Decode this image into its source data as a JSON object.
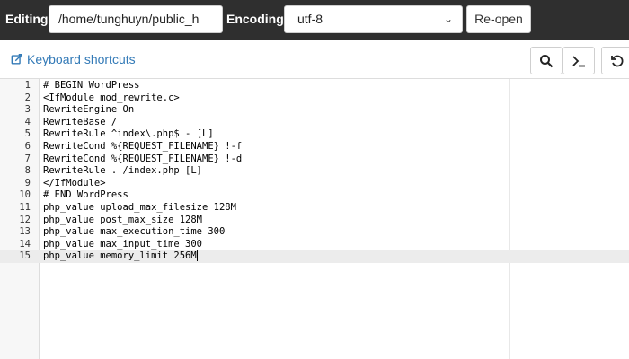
{
  "header": {
    "editing_label": "Editing:",
    "path_value": "/home/tunghuyn/public_h",
    "encoding_label": "Encoding:",
    "encoding_value": "utf-8",
    "reopen_label": "Re-open"
  },
  "toolbar": {
    "keyboard_shortcuts_label": "Keyboard shortcuts",
    "buttons": [
      "search-icon",
      "terminal-icon",
      "undo-icon"
    ]
  },
  "colors": {
    "topbar_bg": "#2f2f2f",
    "link": "#337ab7",
    "active_line": "#ececec"
  },
  "editor": {
    "active_line": 15,
    "lines": [
      {
        "n": "1",
        "text": "# BEGIN WordPress"
      },
      {
        "n": "2",
        "text": "<IfModule mod_rewrite.c>"
      },
      {
        "n": "3",
        "text": "RewriteEngine On"
      },
      {
        "n": "4",
        "text": "RewriteBase /"
      },
      {
        "n": "5",
        "text": "RewriteRule ^index\\.php$ - [L]"
      },
      {
        "n": "6",
        "text": "RewriteCond %{REQUEST_FILENAME} !-f"
      },
      {
        "n": "7",
        "text": "RewriteCond %{REQUEST_FILENAME} !-d"
      },
      {
        "n": "8",
        "text": "RewriteRule . /index.php [L]"
      },
      {
        "n": "9",
        "text": "</IfModule>"
      },
      {
        "n": "10",
        "text": "# END WordPress"
      },
      {
        "n": "11",
        "text": "php_value upload_max_filesize 128M"
      },
      {
        "n": "12",
        "text": "php_value post_max_size 128M"
      },
      {
        "n": "13",
        "text": "php_value max_execution_time 300"
      },
      {
        "n": "14",
        "text": "php_value max_input_time 300"
      },
      {
        "n": "15",
        "text": "php_value memory_limit 256M"
      }
    ]
  }
}
